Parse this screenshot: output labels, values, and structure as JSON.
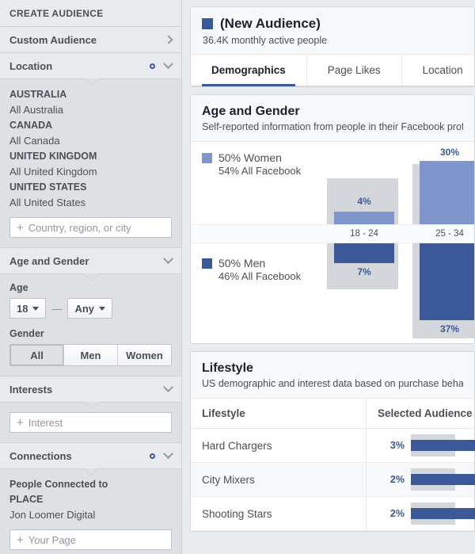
{
  "sidebar": {
    "title": "CREATE AUDIENCE",
    "custom_audience": {
      "label": "Custom Audience",
      "chevron": "chevron-right-icon"
    },
    "location": {
      "label": "Location",
      "gear": "gear-icon",
      "chevron": "chevron-down-icon"
    },
    "locations": [
      {
        "country": "AUSTRALIA",
        "place": "All Australia"
      },
      {
        "country": "CANADA",
        "place": "All Canada"
      },
      {
        "country": "UNITED KINGDOM",
        "place": "All United Kingdom"
      },
      {
        "country": "UNITED STATES",
        "place": "All United States"
      }
    ],
    "location_input_placeholder": "Country, region, or city",
    "age_and_gender": {
      "label": "Age and Gender",
      "chevron": "chevron-down-icon"
    },
    "age_label": "Age",
    "age_min": "18",
    "age_max": "Any",
    "age_dash": "—",
    "gender_label": "Gender",
    "gender_options": [
      "All",
      "Men",
      "Women"
    ],
    "gender_selected": "All",
    "interests": {
      "label": "Interests",
      "chevron": "chevron-down-icon"
    },
    "interest_input_placeholder": "Interest",
    "connections": {
      "label": "Connections",
      "gear": "gear-icon",
      "chevron": "chevron-down-icon"
    },
    "connections_heading": "People Connected to",
    "connections_subheading": "PLACE",
    "connections_page": "Jon Loomer Digital",
    "page_input_placeholder": "Your Page"
  },
  "header": {
    "audience_name": "(New Audience)",
    "audience_meta": "36.4K monthly active people",
    "swatch_color": "#3b5998"
  },
  "tabs": [
    {
      "label": "Demographics",
      "active": true
    },
    {
      "label": "Page Likes",
      "active": false
    },
    {
      "label": "Location",
      "active": false
    }
  ],
  "age_gender": {
    "title": "Age and Gender",
    "description": "Self-reported information from people in their Facebook profiles. In",
    "legend": [
      {
        "label": "50% Women",
        "sub": "54% All Facebook",
        "color": "#7f96cc"
      },
      {
        "label": "50% Men",
        "sub": "46% All Facebook",
        "color": "#3b5998"
      }
    ]
  },
  "chart_data": {
    "type": "bar",
    "title": "Age and Gender",
    "categories": [
      "18 - 24",
      "25 - 34"
    ],
    "series": [
      {
        "name": "Women",
        "color": "#7f96cc",
        "values": [
          4,
          30
        ],
        "labels": [
          "4%",
          "30%"
        ]
      },
      {
        "name": "Men",
        "color": "#3b5998",
        "values": [
          7,
          37
        ],
        "labels": [
          "7%",
          "37%"
        ]
      }
    ],
    "xlabel": "",
    "ylabel": "",
    "ylim": [
      0,
      40
    ],
    "grid": false,
    "legend_position": "left",
    "note": "Diverging bar chart: Women plotted upward, Men plotted downward from a central age-label axis. Column 25-34 is partially cut off at the right edge of the viewport."
  },
  "lifestyle": {
    "title": "Lifestyle",
    "description": "US demographic and interest data based on purchase behavior, b",
    "columns": [
      "Lifestyle",
      "Selected Audience"
    ],
    "rows": [
      {
        "name": "Hard Chargers",
        "pct": "3%",
        "value": 3
      },
      {
        "name": "City Mixers",
        "pct": "2%",
        "value": 2
      },
      {
        "name": "Shooting Stars",
        "pct": "2%",
        "value": 2
      }
    ]
  }
}
